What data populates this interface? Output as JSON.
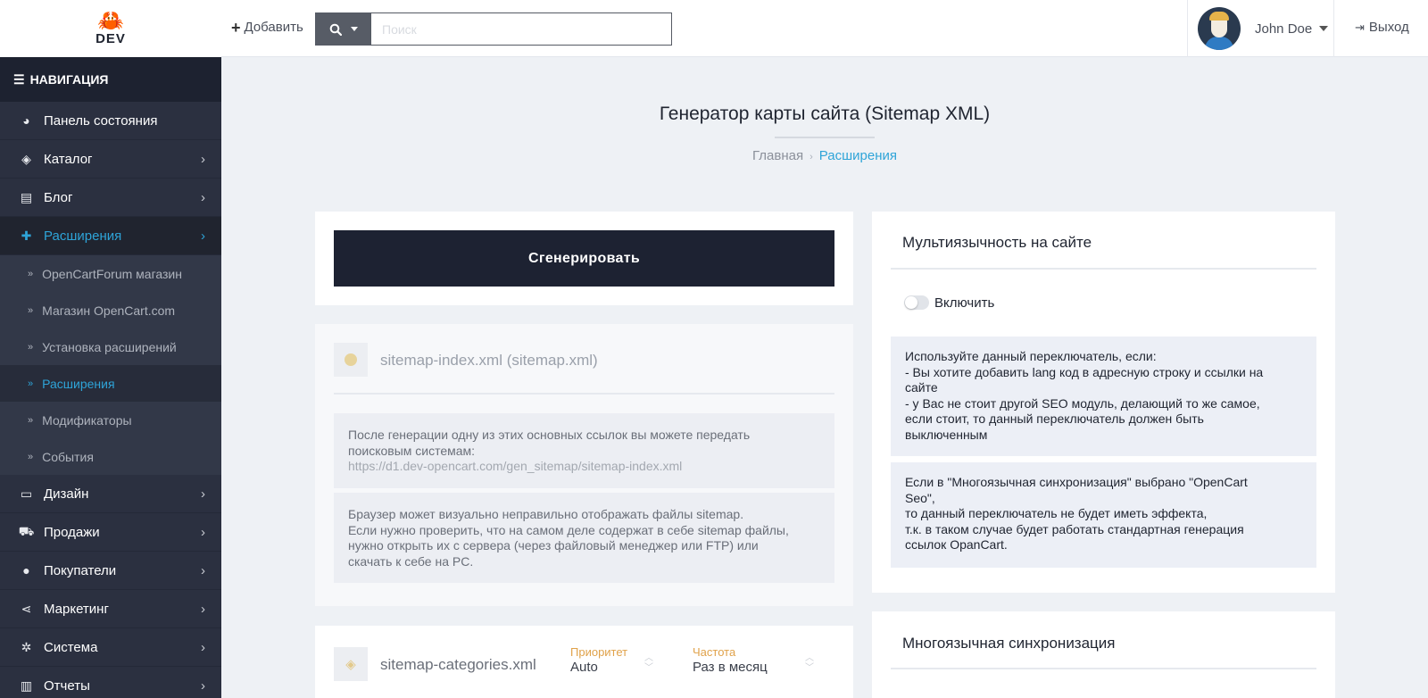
{
  "header": {
    "logo_text": "DEV",
    "add_label": "Добавить",
    "search_placeholder": "Поиск",
    "user_name": "John Doe",
    "logout_label": "Выход"
  },
  "sidebar": {
    "nav_title": "НАВИГАЦИЯ",
    "items": [
      {
        "label": "Панель состояния",
        "icon": "dashboard-icon",
        "has_children": false
      },
      {
        "label": "Каталог",
        "icon": "tags-icon",
        "has_children": true
      },
      {
        "label": "Блог",
        "icon": "book-icon",
        "has_children": true
      },
      {
        "label": "Расширения",
        "icon": "puzzle-icon",
        "has_children": true,
        "active": true
      },
      {
        "label": "Дизайн",
        "icon": "monitor-icon",
        "has_children": true
      },
      {
        "label": "Продажи",
        "icon": "cart-icon",
        "has_children": true
      },
      {
        "label": "Покупатели",
        "icon": "user-icon",
        "has_children": true
      },
      {
        "label": "Маркетинг",
        "icon": "share-icon",
        "has_children": true
      },
      {
        "label": "Система",
        "icon": "cog-icon",
        "has_children": true
      },
      {
        "label": "Отчеты",
        "icon": "bar-chart-icon",
        "has_children": true
      }
    ],
    "sub_items": [
      {
        "label": "OpenCartForum магазин"
      },
      {
        "label": "Магазин OpenCart.com"
      },
      {
        "label": "Установка расширений"
      },
      {
        "label": "Расширения",
        "active": true
      },
      {
        "label": "Модификаторы"
      },
      {
        "label": "События"
      }
    ]
  },
  "page": {
    "title": "Генератор карты сайта (Sitemap XML)",
    "breadcrumb": [
      "Главная",
      "Расширения"
    ]
  },
  "generate": {
    "button_label": "Сгенерировать"
  },
  "sitemap_index": {
    "title": "sitemap-index.xml (sitemap.xml)",
    "note1_line1": "После генерации одну из этих основных ссылок вы можете передать",
    "note1_line2": "поисковым системам:",
    "note1_link": "https://d1.dev-opencart.com/gen_sitemap/sitemap-index.xml",
    "note2_line1": "Браузер может визуально неправильно отображать файлы sitemap.",
    "note2_line2": "Если нужно проверить, что на самом деле содержат в себе sitemap файлы,",
    "note2_line3": "нужно открыть их с сервера (через файловый менеджер или FTP) или",
    "note2_line4": "скачать к себе на PC."
  },
  "sitemap_categories": {
    "title": "sitemap-categories.xml",
    "priority_label": "Приоритет",
    "priority_value": "Auto",
    "frequency_label": "Частота",
    "frequency_value": "Раз в месяц"
  },
  "multilang": {
    "title": "Мультиязычность на сайте",
    "toggle_label": "Включить",
    "toggle_on": false,
    "info1_line1": "Используйте данный переключатель, если:",
    "info1_line2": "- Вы хотите добавить lang код в адресную строку и ссылки на",
    "info1_line3": "сайте",
    "info1_line4": "- у Вас не стоит другой SEO модуль, делающий то же самое,",
    "info1_line5": "если стоит, то данный переключатель должен быть",
    "info1_line6": "выключенным",
    "info2_line1": "Если в \"Многоязычная синхронизация\" выбрано \"OpenCart",
    "info2_line2": "Seo\",",
    "info2_line3": "то данный переключатель не будет иметь эффекта,",
    "info2_line4": "т.к. в таком случае будет работать стандартная генерация",
    "info2_line5": "ссылок OpanCart."
  },
  "sync": {
    "title": "Многоязычная синхронизация"
  },
  "colors": {
    "sidebar_bg": "#2b3040",
    "accent": "#2ea4d8",
    "primary_button": "#1d2232",
    "page_bg": "#eef1f5",
    "label_orange": "#e0a24a"
  }
}
